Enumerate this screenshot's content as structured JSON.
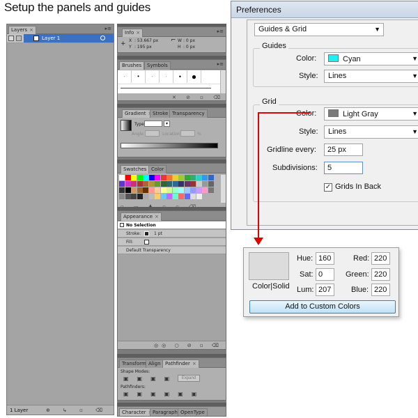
{
  "heading": "Setup the panels and guides",
  "layers_panel": {
    "tab": "Layers",
    "layer_name": "Layer 1",
    "footer": "1 Layer"
  },
  "info_panel": {
    "tab": "Info",
    "x_label": "X",
    "x_value": ": 53.667 px",
    "y_label": "Y",
    "y_value": ": 195 px",
    "w_label": "W",
    "w_value": ": 0 px",
    "h_label": "H",
    "h_value": ": 0 px"
  },
  "brushes_panel": {
    "tabs": [
      "Brushes",
      "Symbols"
    ]
  },
  "gradient_panel": {
    "tabs": [
      "Gradient",
      "Stroke",
      "Transparency"
    ],
    "type_label": "Type:",
    "angle_label": "Angle",
    "location_label": "Location",
    "percent": "%"
  },
  "swatches_panel": {
    "tabs": [
      "Swatches",
      "Color"
    ]
  },
  "appearance_panel": {
    "tab": "Appearance",
    "rows": [
      "No Selection",
      "Stroke:",
      "Fill:",
      "Default Transparency"
    ],
    "stroke_value": "1 pt"
  },
  "pathfinder_panel": {
    "tabs": [
      "Transform",
      "Align",
      "Pathfinder"
    ],
    "shape_modes": "Shape Modes:",
    "expand": "Expand",
    "pathfinders": "Pathfinders:"
  },
  "character_panel": {
    "tabs": [
      "Character",
      "Paragraph",
      "OpenType"
    ]
  },
  "preferences": {
    "title": "Preferences",
    "section": "Guides & Grid",
    "guides_group": "Guides",
    "guides_color_label": "Color:",
    "guides_color": "Cyan",
    "guides_color_hex": "#1ef0f0",
    "guides_style_label": "Style:",
    "guides_style": "Lines",
    "grid_group": "Grid",
    "grid_color_label": "Color:",
    "grid_color": "Light Gray",
    "grid_color_hex": "#7a7a7a",
    "grid_style_label": "Style:",
    "grid_style": "Lines",
    "gridline_label": "Gridline every:",
    "gridline_value": "25 px",
    "subdivisions_label": "Subdivisions:",
    "subdivisions_value": "5",
    "grids_in_back": "Grids In Back",
    "grids_in_back_checked": true
  },
  "color_picker": {
    "preview_label": "Color|Solid",
    "hue_label": "Hue:",
    "hue": "160",
    "sat_label": "Sat:",
    "sat": "0",
    "lum_label": "Lum:",
    "lum": "207",
    "red_label": "Red:",
    "red": "220",
    "green_label": "Green:",
    "green": "220",
    "blue_label": "Blue:",
    "blue": "220",
    "add_button": "Add to Custom Colors"
  },
  "accent_color": "#e00000"
}
